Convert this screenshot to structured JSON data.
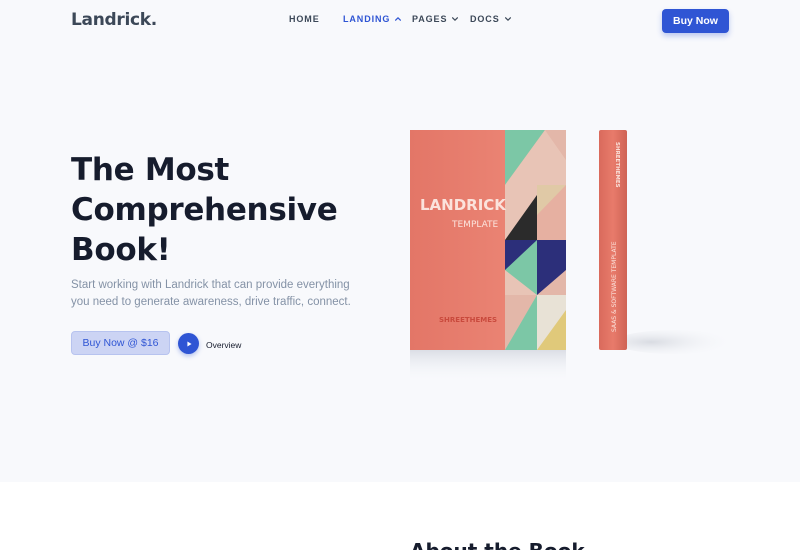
{
  "header": {
    "logo": "Landrick.",
    "nav": [
      {
        "label": "HOME",
        "active": false,
        "dropdown": false
      },
      {
        "label": "LANDING",
        "active": true,
        "dropdown": true,
        "icon": "chevron-up-icon"
      },
      {
        "label": "PAGES",
        "active": false,
        "dropdown": true,
        "icon": "chevron-down-icon"
      },
      {
        "label": "DOCS",
        "active": false,
        "dropdown": true,
        "icon": "chevron-down-icon"
      }
    ],
    "buy_now_label": "Buy Now"
  },
  "hero": {
    "title": "The Most Comprehensive Book!",
    "description": "Start working with Landrick that can provide everything you need to generate awareness, drive traffic, connect.",
    "buy_label": "Buy Now @ $16",
    "play_icon": "play-icon",
    "overview_label": "Overview"
  },
  "book": {
    "title": "LANDRICK",
    "subtitle": "TEMPLATE",
    "publisher": "SHREETHEMES",
    "spine_top": "SHREETHEMES",
    "spine_text": "SAAS & SOFTWARE TEMPLATE"
  },
  "about": {
    "title": "About the Book"
  },
  "colors": {
    "primary": "#2f55d4",
    "hero_bg": "#f8f9fc",
    "heading": "#161c2d",
    "muted": "#8492a6",
    "book_cover": "#e87b6b"
  }
}
